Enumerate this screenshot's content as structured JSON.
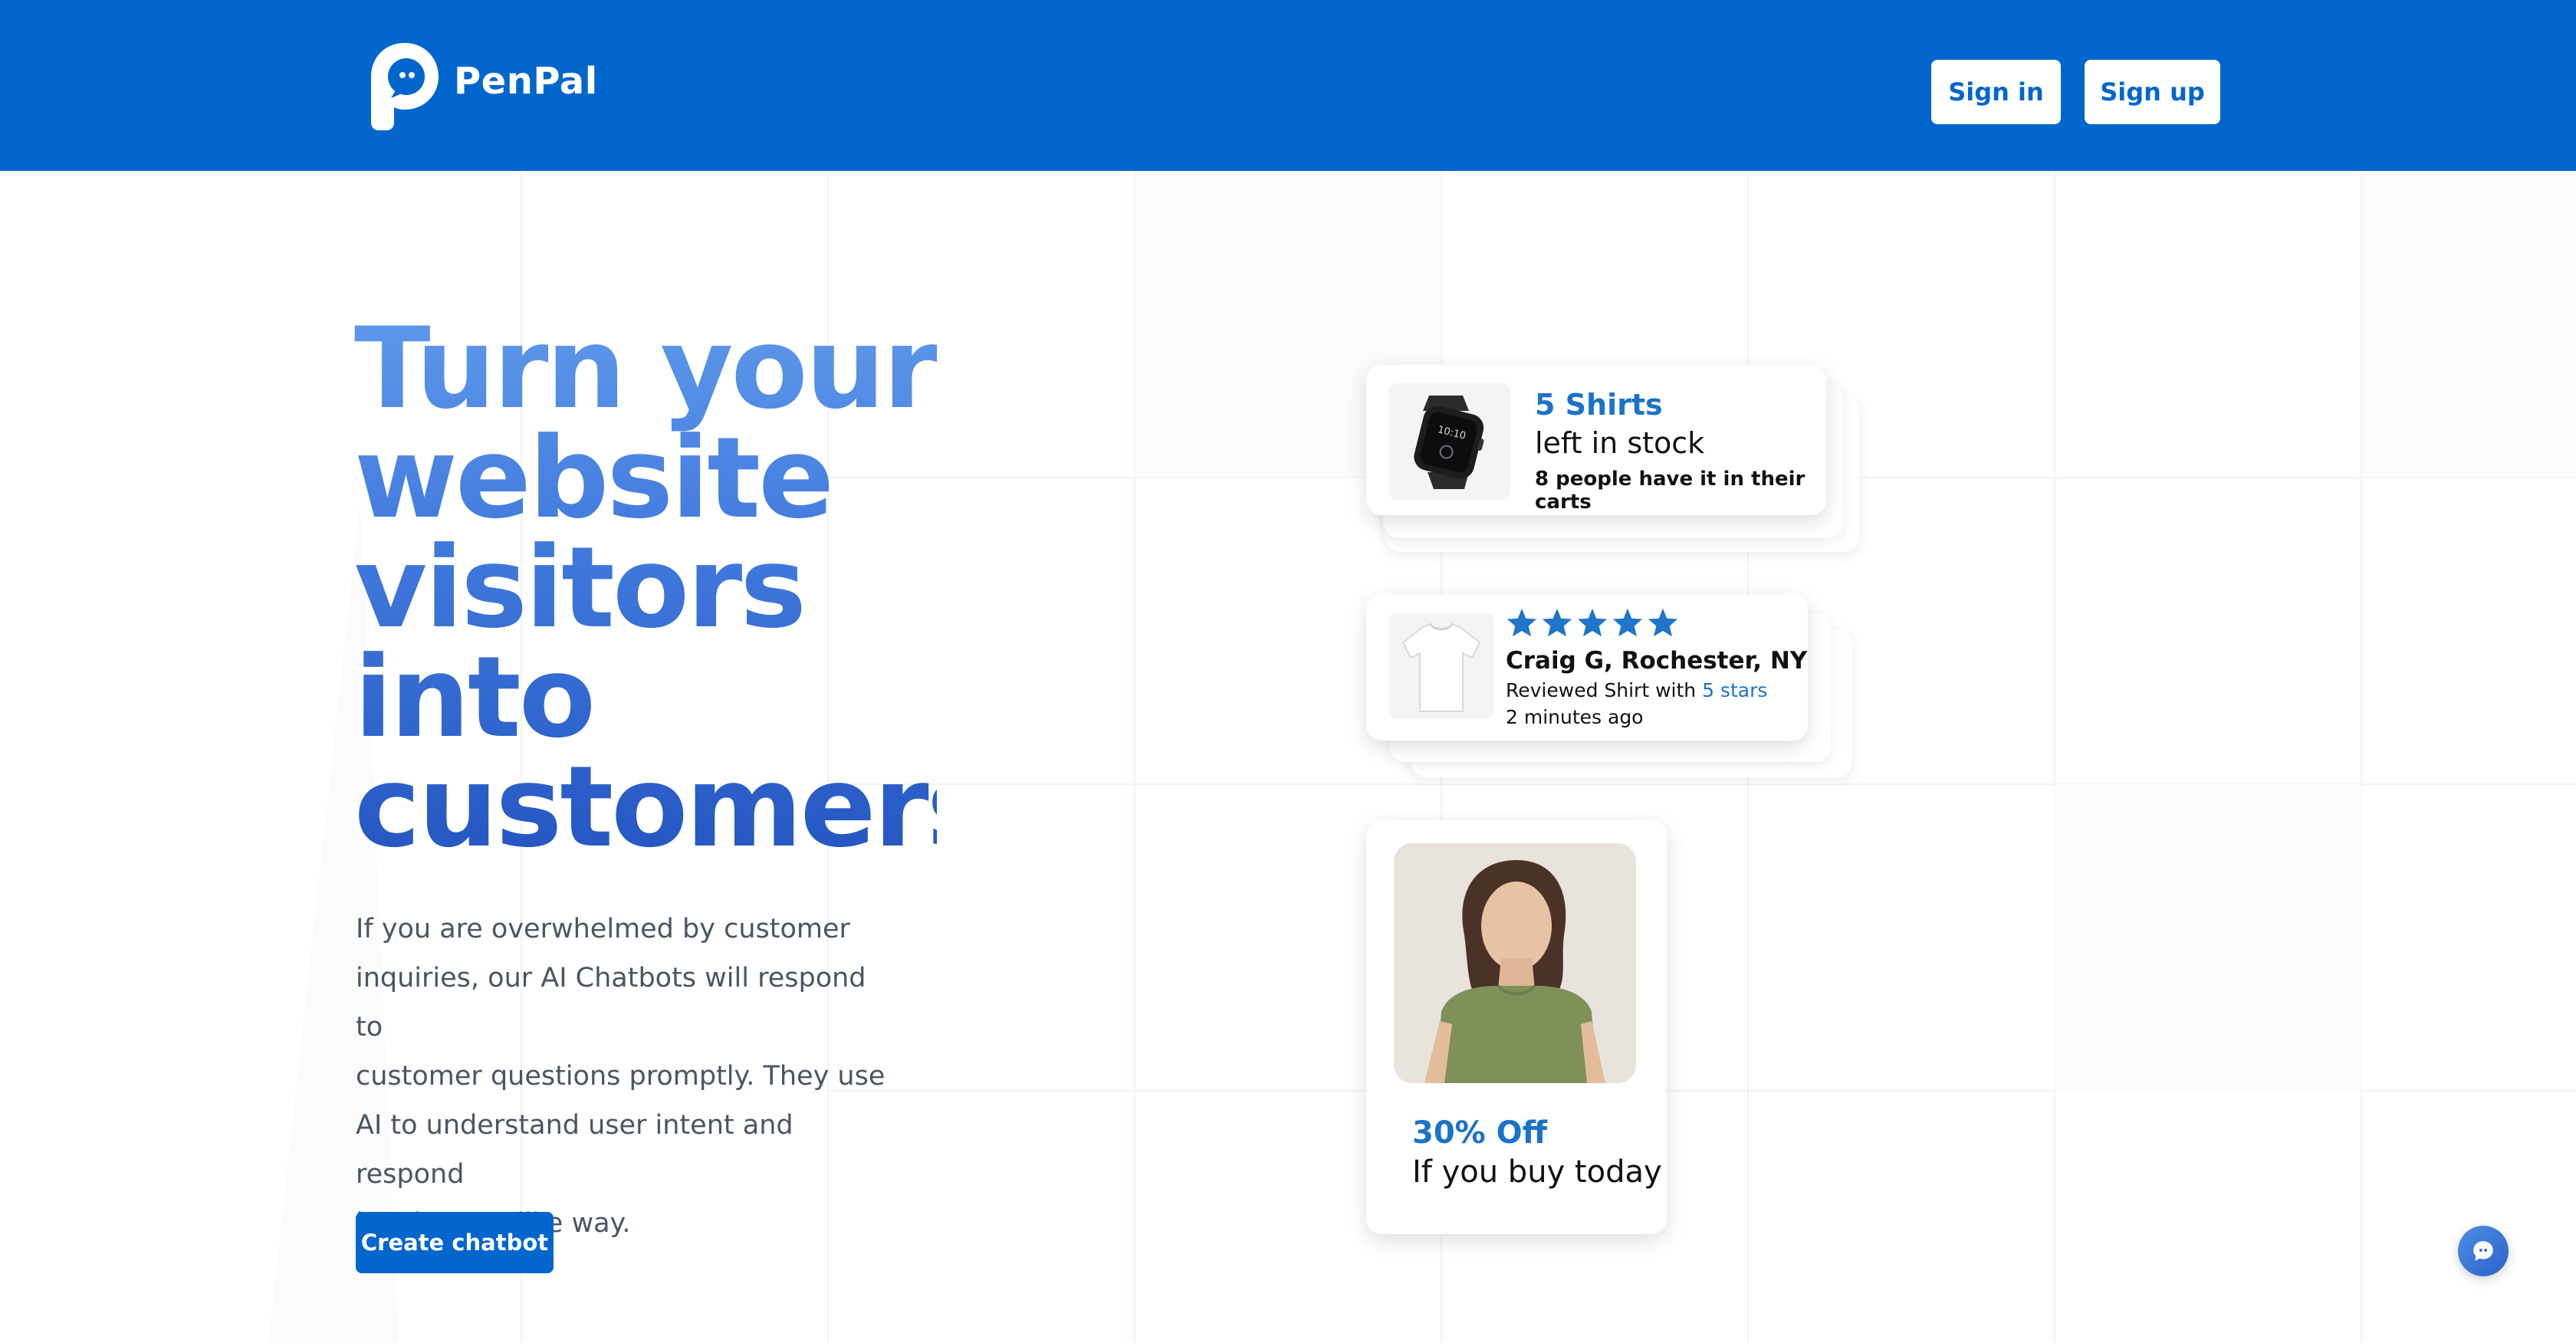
{
  "brand": {
    "name": "PenPal"
  },
  "header": {
    "signin_label": "Sign in",
    "signup_label": "Sign up"
  },
  "hero": {
    "title_lines": [
      "Turn your",
      "website",
      "visitors",
      "into",
      "customers"
    ],
    "description_lines": [
      "If you are overwhelmed by customer",
      "inquiries, our AI Chatbots will respond to",
      "customer questions promptly. They use",
      "AI to understand user intent and respond",
      "in a human-like way."
    ],
    "cta_label": "Create chatbot"
  },
  "cards": {
    "stock": {
      "count_text": "5 Shirts",
      "subtitle": "left in stock",
      "carts_text": "8 people have it in their carts",
      "image_icon": "smartwatch-icon"
    },
    "review": {
      "rating": 5,
      "reviewer": "Craig G, Rochester, NY",
      "reviewed_prefix": "Reviewed Shirt with",
      "reviewed_stars": "5 stars",
      "time_ago": "2 minutes ago",
      "image_icon": "tshirt-icon"
    },
    "promo": {
      "discount": "30% Off",
      "condition": "If you buy today",
      "image_icon": "model-photo"
    }
  },
  "colors": {
    "brand_blue": "#0266cc",
    "accent_blue": "#1a73c8",
    "star_blue": "#1f75c9"
  },
  "chat_widget": {
    "icon": "chat-bubble-icon"
  }
}
